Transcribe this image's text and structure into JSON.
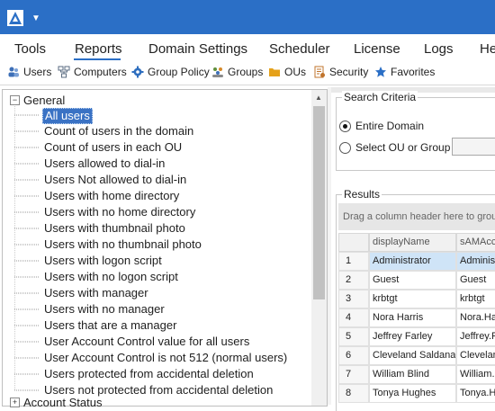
{
  "titlebar": {
    "logo_icon": "app-logo-icon",
    "menu_caret": "▼"
  },
  "menu": {
    "items": [
      "Tools",
      "Reports",
      "Domain Settings",
      "Scheduler",
      "License",
      "Logs",
      "He"
    ],
    "active": "Reports"
  },
  "toolbar": {
    "items": [
      {
        "label": "Users",
        "icon": "users-icon",
        "color": "#3d6fb7"
      },
      {
        "label": "Computers",
        "icon": "computers-icon",
        "color": "#5a6b80"
      },
      {
        "label": "Group Policy",
        "icon": "gear-icon",
        "color": "#2f6fbf"
      },
      {
        "label": "Groups",
        "icon": "groups-icon",
        "color": "#5f8f3a"
      },
      {
        "label": "OUs",
        "icon": "folder-icon",
        "color": "#e5a11a"
      },
      {
        "label": "Security",
        "icon": "security-icon",
        "color": "#c0742c"
      },
      {
        "label": "Favorites",
        "icon": "star-icon",
        "color": "#2b6fc6"
      }
    ]
  },
  "tree": {
    "root_label": "General",
    "expander_collapse": "−",
    "expander_expand": "+",
    "items": [
      "All users",
      "Count of users in the domain",
      "Count of users in each OU",
      "Users allowed to dial-in",
      "Users Not allowed to dial-in",
      "Users with home directory",
      "Users with no home directory",
      "Users with thumbnail photo",
      "Users with no thumbnail photo",
      "Users with logon script",
      "Users with no logon script",
      "Users with manager",
      "Users with no manager",
      "Users that are a manager",
      "User Account Control value for all users",
      "User Account Control is not 512 (normal users)",
      "Users protected from accidental deletion",
      "Users not protected from accidental deletion"
    ],
    "selected_index": 0,
    "next_root_label": "Account Status"
  },
  "search_criteria": {
    "title": "Search Criteria",
    "option_domain": "Entire Domain",
    "option_ou": "Select OU or Group",
    "selected": "Entire Domain"
  },
  "results": {
    "title": "Results",
    "group_hint": "Drag a column header here to group by that column",
    "columns": [
      "displayName",
      "sAMAccountName"
    ],
    "rows": [
      {
        "n": "1",
        "displayName": "Administrator",
        "sam": "Administrator"
      },
      {
        "n": "2",
        "displayName": "Guest",
        "sam": "Guest"
      },
      {
        "n": "3",
        "displayName": "krbtgt",
        "sam": "krbtgt"
      },
      {
        "n": "4",
        "displayName": "Nora Harris",
        "sam": "Nora.Harris"
      },
      {
        "n": "5",
        "displayName": "Jeffrey Farley",
        "sam": "Jeffrey.Farley"
      },
      {
        "n": "6",
        "displayName": "Cleveland Saldana",
        "sam": "Cleveland.Saldana"
      },
      {
        "n": "7",
        "displayName": "William Blind",
        "sam": "William.Blind"
      },
      {
        "n": "8",
        "displayName": "Tonya Hughes",
        "sam": "Tonya.Hughes"
      }
    ],
    "selected_row": 0
  },
  "colors": {
    "titlebar": "#2b6fc6",
    "selection": "#3a72c4",
    "row_selection": "#cfe4f7"
  }
}
